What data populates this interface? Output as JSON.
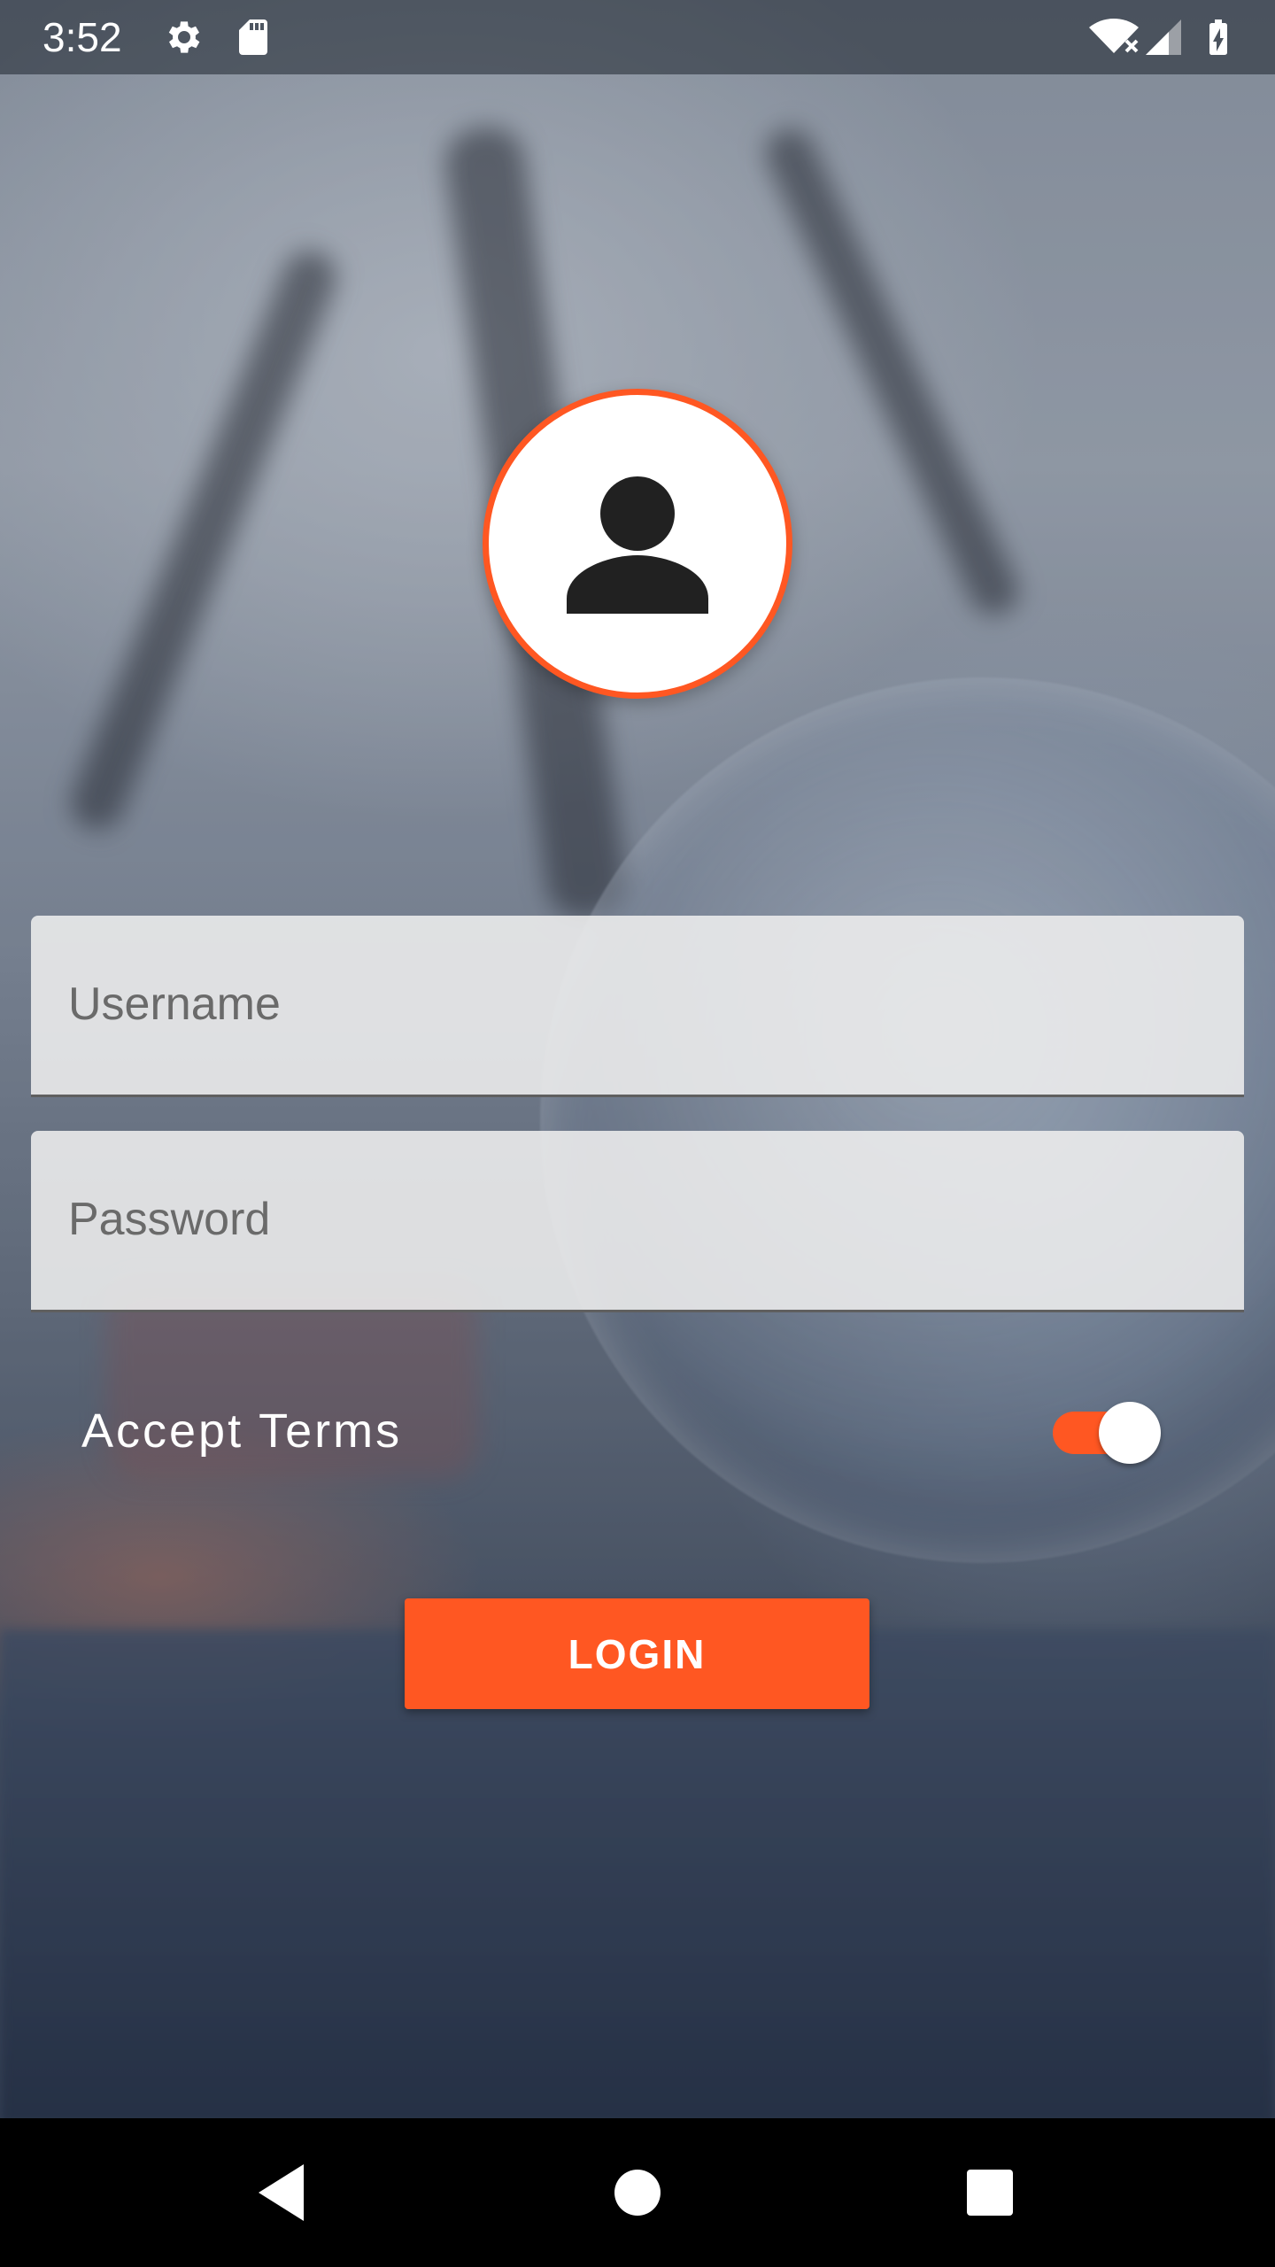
{
  "status_bar": {
    "time": "3:52",
    "icons": [
      "gear-icon",
      "sd-card-icon",
      "wifi-icon",
      "cell-signal-icon",
      "battery-charging-icon"
    ]
  },
  "avatar": {
    "icon": "person-icon",
    "border_color": "#ff5722"
  },
  "form": {
    "username": {
      "value": "",
      "placeholder": "Username"
    },
    "password": {
      "value": "",
      "placeholder": "Password"
    },
    "accept_terms": {
      "label": "Accept Terms",
      "checked": true
    },
    "login_label": "LOGIN"
  },
  "navigation": {
    "items": [
      "back-icon",
      "home-icon",
      "recents-icon"
    ]
  },
  "colors": {
    "accent": "#ff5722",
    "field_background": "#eeeeee",
    "nav_bar": "#000000"
  }
}
